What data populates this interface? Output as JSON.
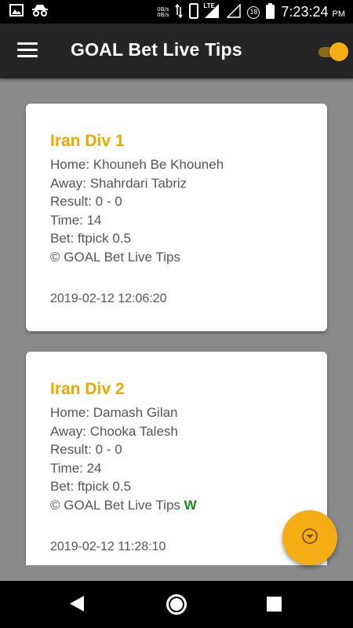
{
  "status_bar": {
    "net_speed_up": "0B/s",
    "net_speed_down": "0B/s",
    "network": "LTE",
    "notification_badge": "18",
    "time": "7:23:24",
    "ampm": "PM",
    "icons": [
      "image-icon",
      "incognito-icon",
      "data-transfer-icon",
      "phone-icon",
      "signal-icon",
      "signal-empty-icon",
      "notification-badge-icon",
      "battery-icon"
    ]
  },
  "app_bar": {
    "title": "GOAL Bet Live Tips",
    "menu_icon": "hamburger-menu-icon",
    "toggle_on": true,
    "accent_color": "#f4ad14"
  },
  "cards": [
    {
      "title": "Iran Div 1",
      "home": "Home: Khouneh Be Khouneh",
      "away": "Away: Shahrdari Tabriz",
      "result": "Result: 0 - 0",
      "time": "Time: 14",
      "bet": "Bet: ftpick 0.5",
      "footer": "© GOAL Bet Live Tips",
      "outcome": "",
      "date": "2019-02-12 12:06:20"
    },
    {
      "title": "Iran Div 2",
      "home": "Home: Damash Gilan",
      "away": "Away: Chooka Talesh",
      "result": "Result: 0 - 0",
      "time": "Time: 24",
      "bet": "Bet: ftpick 0.5",
      "footer": "© GOAL Bet Live Tips",
      "outcome": "W",
      "date": "2019-02-12 11:28:10"
    }
  ],
  "colors": {
    "title": "#f0a800",
    "win": "#1a8a1a",
    "background": "#8a8a8a",
    "app_bar": "#252525"
  },
  "fab": {
    "icon": "chevron-down-circle-icon"
  },
  "nav_bar": {
    "icons": [
      "back-icon",
      "home-icon",
      "recent-apps-icon"
    ]
  }
}
